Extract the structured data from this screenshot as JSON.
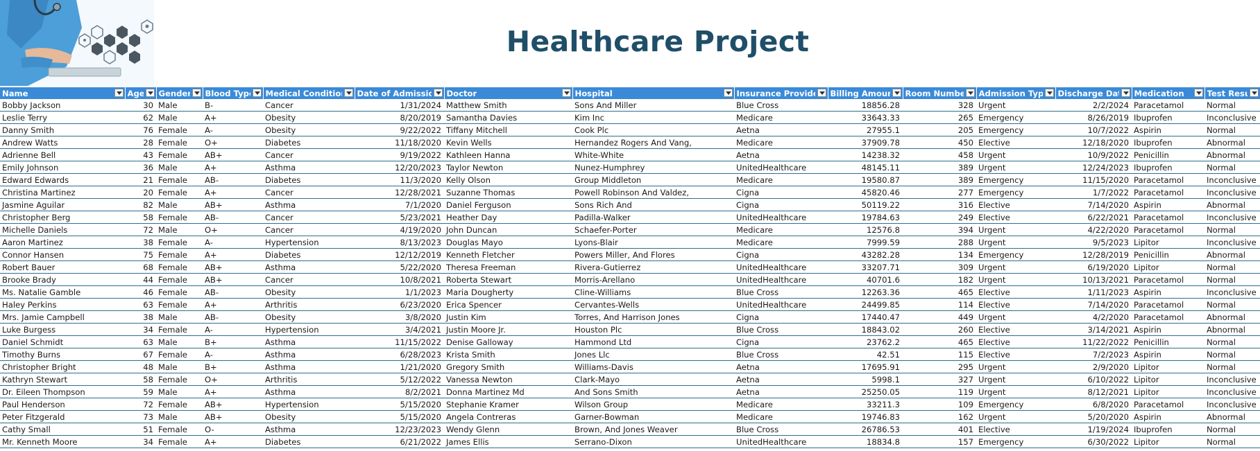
{
  "title": "Healthcare Project",
  "columns": [
    "Name",
    "Age",
    "Gender",
    "Blood Type",
    "Medical Condition",
    "Date of Admission",
    "Doctor",
    "Hospital",
    "Insurance Provider",
    "Billing Amount",
    "Room Number",
    "Admission Type",
    "Discharge Date",
    "Medication",
    "Test Results"
  ],
  "rows": [
    [
      "Bobby Jackson",
      "30",
      "Male",
      "B-",
      "Cancer",
      "1/31/2024",
      "Matthew Smith",
      "Sons And Miller",
      "Blue Cross",
      "18856.28",
      "328",
      "Urgent",
      "2/2/2024",
      "Paracetamol",
      "Normal"
    ],
    [
      "Leslie Terry",
      "62",
      "Male",
      "A+",
      "Obesity",
      "8/20/2019",
      "Samantha Davies",
      "Kim Inc",
      "Medicare",
      "33643.33",
      "265",
      "Emergency",
      "8/26/2019",
      "Ibuprofen",
      "Inconclusive"
    ],
    [
      "Danny Smith",
      "76",
      "Female",
      "A-",
      "Obesity",
      "9/22/2022",
      "Tiffany Mitchell",
      "Cook Plc",
      "Aetna",
      "27955.1",
      "205",
      "Emergency",
      "10/7/2022",
      "Aspirin",
      "Normal"
    ],
    [
      "Andrew Watts",
      "28",
      "Female",
      "O+",
      "Diabetes",
      "11/18/2020",
      "Kevin Wells",
      "Hernandez Rogers And Vang,",
      "Medicare",
      "37909.78",
      "450",
      "Elective",
      "12/18/2020",
      "Ibuprofen",
      "Abnormal"
    ],
    [
      "Adrienne Bell",
      "43",
      "Female",
      "AB+",
      "Cancer",
      "9/19/2022",
      "Kathleen Hanna",
      "White-White",
      "Aetna",
      "14238.32",
      "458",
      "Urgent",
      "10/9/2022",
      "Penicillin",
      "Abnormal"
    ],
    [
      "Emily Johnson",
      "36",
      "Male",
      "A+",
      "Asthma",
      "12/20/2023",
      "Taylor Newton",
      "Nunez-Humphrey",
      "UnitedHealthcare",
      "48145.11",
      "389",
      "Urgent",
      "12/24/2023",
      "Ibuprofen",
      "Normal"
    ],
    [
      "Edward Edwards",
      "21",
      "Female",
      "AB-",
      "Diabetes",
      "11/3/2020",
      "Kelly Olson",
      "Group Middleton",
      "Medicare",
      "19580.87",
      "389",
      "Emergency",
      "11/15/2020",
      "Paracetamol",
      "Inconclusive"
    ],
    [
      "Christina Martinez",
      "20",
      "Female",
      "A+",
      "Cancer",
      "12/28/2021",
      "Suzanne Thomas",
      "Powell Robinson And Valdez,",
      "Cigna",
      "45820.46",
      "277",
      "Emergency",
      "1/7/2022",
      "Paracetamol",
      "Inconclusive"
    ],
    [
      "Jasmine Aguilar",
      "82",
      "Male",
      "AB+",
      "Asthma",
      "7/1/2020",
      "Daniel Ferguson",
      "Sons Rich And",
      "Cigna",
      "50119.22",
      "316",
      "Elective",
      "7/14/2020",
      "Aspirin",
      "Abnormal"
    ],
    [
      "Christopher Berg",
      "58",
      "Female",
      "AB-",
      "Cancer",
      "5/23/2021",
      "Heather Day",
      "Padilla-Walker",
      "UnitedHealthcare",
      "19784.63",
      "249",
      "Elective",
      "6/22/2021",
      "Paracetamol",
      "Inconclusive"
    ],
    [
      "Michelle Daniels",
      "72",
      "Male",
      "O+",
      "Cancer",
      "4/19/2020",
      "John Duncan",
      "Schaefer-Porter",
      "Medicare",
      "12576.8",
      "394",
      "Urgent",
      "4/22/2020",
      "Paracetamol",
      "Normal"
    ],
    [
      "Aaron Martinez",
      "38",
      "Female",
      "A-",
      "Hypertension",
      "8/13/2023",
      "Douglas Mayo",
      "Lyons-Blair",
      "Medicare",
      "7999.59",
      "288",
      "Urgent",
      "9/5/2023",
      "Lipitor",
      "Inconclusive"
    ],
    [
      "Connor Hansen",
      "75",
      "Female",
      "A+",
      "Diabetes",
      "12/12/2019",
      "Kenneth Fletcher",
      "Powers Miller, And Flores",
      "Cigna",
      "43282.28",
      "134",
      "Emergency",
      "12/28/2019",
      "Penicillin",
      "Abnormal"
    ],
    [
      "Robert Bauer",
      "68",
      "Female",
      "AB+",
      "Asthma",
      "5/22/2020",
      "Theresa Freeman",
      "Rivera-Gutierrez",
      "UnitedHealthcare",
      "33207.71",
      "309",
      "Urgent",
      "6/19/2020",
      "Lipitor",
      "Normal"
    ],
    [
      "Brooke Brady",
      "44",
      "Female",
      "AB+",
      "Cancer",
      "10/8/2021",
      "Roberta Stewart",
      "Morris-Arellano",
      "UnitedHealthcare",
      "40701.6",
      "182",
      "Urgent",
      "10/13/2021",
      "Paracetamol",
      "Normal"
    ],
    [
      "Ms. Natalie Gamble",
      "46",
      "Female",
      "AB-",
      "Obesity",
      "1/1/2023",
      "Maria Dougherty",
      "Cline-Williams",
      "Blue Cross",
      "12263.36",
      "465",
      "Elective",
      "1/11/2023",
      "Aspirin",
      "Inconclusive"
    ],
    [
      "Haley Perkins",
      "63",
      "Female",
      "A+",
      "Arthritis",
      "6/23/2020",
      "Erica Spencer",
      "Cervantes-Wells",
      "UnitedHealthcare",
      "24499.85",
      "114",
      "Elective",
      "7/14/2020",
      "Paracetamol",
      "Normal"
    ],
    [
      "Mrs. Jamie Campbell",
      "38",
      "Male",
      "AB-",
      "Obesity",
      "3/8/2020",
      "Justin Kim",
      "Torres, And Harrison Jones",
      "Cigna",
      "17440.47",
      "449",
      "Urgent",
      "4/2/2020",
      "Paracetamol",
      "Abnormal"
    ],
    [
      "Luke Burgess",
      "34",
      "Female",
      "A-",
      "Hypertension",
      "3/4/2021",
      "Justin Moore Jr.",
      "Houston Plc",
      "Blue Cross",
      "18843.02",
      "260",
      "Elective",
      "3/14/2021",
      "Aspirin",
      "Abnormal"
    ],
    [
      "Daniel Schmidt",
      "63",
      "Male",
      "B+",
      "Asthma",
      "11/15/2022",
      "Denise Galloway",
      "Hammond Ltd",
      "Cigna",
      "23762.2",
      "465",
      "Elective",
      "11/22/2022",
      "Penicillin",
      "Normal"
    ],
    [
      "Timothy Burns",
      "67",
      "Female",
      "A-",
      "Asthma",
      "6/28/2023",
      "Krista Smith",
      "Jones Llc",
      "Blue Cross",
      "42.51",
      "115",
      "Elective",
      "7/2/2023",
      "Aspirin",
      "Normal"
    ],
    [
      "Christopher Bright",
      "48",
      "Male",
      "B+",
      "Asthma",
      "1/21/2020",
      "Gregory Smith",
      "Williams-Davis",
      "Aetna",
      "17695.91",
      "295",
      "Urgent",
      "2/9/2020",
      "Lipitor",
      "Normal"
    ],
    [
      "Kathryn Stewart",
      "58",
      "Female",
      "O+",
      "Arthritis",
      "5/12/2022",
      "Vanessa Newton",
      "Clark-Mayo",
      "Aetna",
      "5998.1",
      "327",
      "Urgent",
      "6/10/2022",
      "Lipitor",
      "Inconclusive"
    ],
    [
      "Dr. Eileen Thompson",
      "59",
      "Male",
      "A+",
      "Asthma",
      "8/2/2021",
      "Donna Martinez Md",
      "And Sons Smith",
      "Aetna",
      "25250.05",
      "119",
      "Urgent",
      "8/12/2021",
      "Lipitor",
      "Inconclusive"
    ],
    [
      "Paul Henderson",
      "72",
      "Female",
      "AB+",
      "Hypertension",
      "5/15/2020",
      "Stephanie Kramer",
      "Wilson Group",
      "Medicare",
      "33211.3",
      "109",
      "Emergency",
      "6/8/2020",
      "Paracetamol",
      "Inconclusive"
    ],
    [
      "Peter Fitzgerald",
      "73",
      "Male",
      "AB+",
      "Obesity",
      "5/15/2020",
      "Angela Contreras",
      "Garner-Bowman",
      "Medicare",
      "19746.83",
      "162",
      "Urgent",
      "5/20/2020",
      "Aspirin",
      "Abnormal"
    ],
    [
      "Cathy Small",
      "51",
      "Female",
      "O-",
      "Asthma",
      "12/23/2023",
      "Wendy Glenn",
      "Brown, And Jones Weaver",
      "Blue Cross",
      "26786.53",
      "401",
      "Elective",
      "1/19/2024",
      "Ibuprofen",
      "Normal"
    ],
    [
      "Mr. Kenneth Moore",
      "34",
      "Female",
      "A+",
      "Diabetes",
      "6/21/2022",
      "James Ellis",
      "Serrano-Dixon",
      "UnitedHealthcare",
      "18834.8",
      "157",
      "Emergency",
      "6/30/2022",
      "Lipitor",
      "Normal"
    ]
  ]
}
